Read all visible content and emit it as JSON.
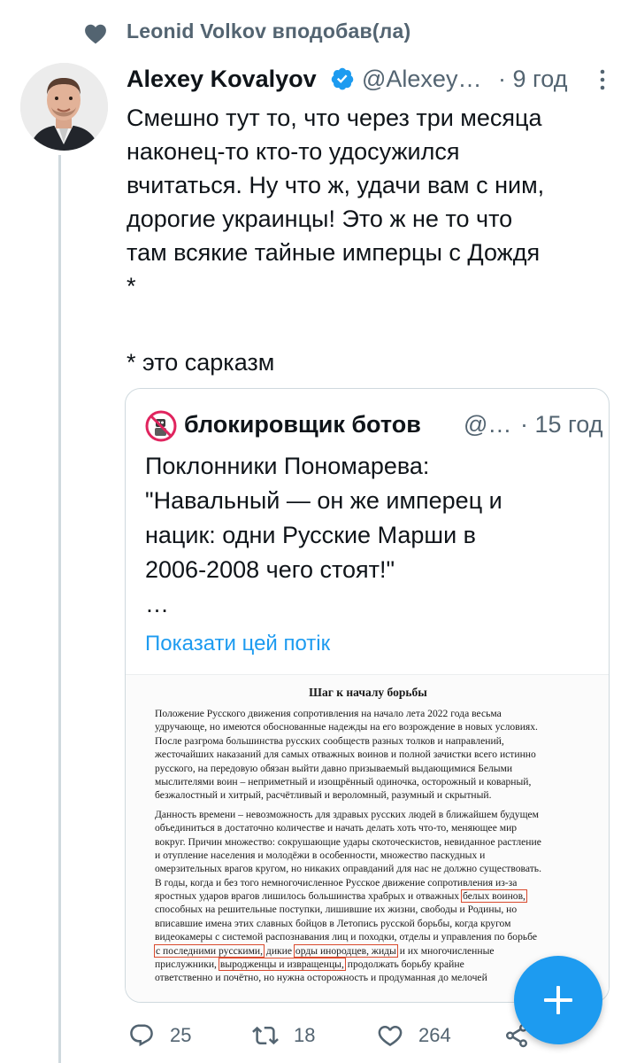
{
  "liked_by": {
    "text": "Leonid Volkov вподобав(ла)"
  },
  "tweet": {
    "author_name": "Alexey Kovalyov",
    "handle": "@Alexey…",
    "time": "· 9 год",
    "text_lines": [
      "Смешно тут то, что через три месяца",
      "наконец-то кто-то удосужился",
      "вчитаться. Ну что ж, удачи вам с ним,",
      "дорогие украинцы! Это ж не то что",
      "там всякие тайные имперцы с Дождя",
      "*",
      "",
      "* это сарказм"
    ]
  },
  "quote": {
    "author_name": "блокировщик ботов",
    "handle": "@…",
    "time": "· 15 год",
    "text_lines": [
      "Поклонники Пономарева:",
      "\"Навальный — он же имперец и",
      "нацик: одни Русские Марши в",
      "2006-2008 чего стоят!\"",
      "…"
    ],
    "show_thread": "Показати цей потік"
  },
  "document": {
    "title": "Шаг к началу борьбы",
    "para1": [
      "Положение Русского движения сопротивления на начало лета 2022 года весьма",
      "удручающе, но имеются обоснованные надежды на его возрождение в новых условиях.",
      "После разгрома большинства русских сообществ разных толков и направлений,",
      "жесточайших наказаний для самых отважных воинов и полной зачистки всего истинно",
      "русского, на передовую обязан выйти давно призываемый выдающимися Белыми",
      "мыслителями воин – неприметный и изощрённый одиночка, осторожный и коварный,",
      "безжалостный и хитрый, расчётливый и вероломный, разумный и скрытный."
    ],
    "para2": [
      "Данность времени – невозможность для здравых русских людей в ближайшем будущем",
      "объединиться в достаточно количестве и начать делать хоть что-то, меняющее мир",
      "вокруг. Причин множество: сокрушающие удары скоточескистов, невиданное растление",
      "и отупление населения и молодёжи в особенности, множество паскудных и",
      "омерзительных врагов кругом, но никаких оправданий для нас не должно существовать.",
      "В годы, когда и без того немногочисленное Русское движение сопротивления из-за",
      "яростных ударов врагов лишилось большинства храбрых и отважных"
    ],
    "hl_white_warriors": "белых воинов,",
    "line_after_hl1": "способных на решительные поступки, лишившие их жизни, свободы и Родины, но",
    "line_b": "вписавшие имена этих славных бойцов в Летопись русской борьбы, когда кругом",
    "line_c": "видеокамеры с системой распознавания лиц и походки, отделы и управления по борьбе",
    "hl_last_russians": "с последними русскими,",
    "mid_d": "дикие",
    "hl_hordes": "орды инородцев, жиды",
    "end_d": "и их многочисленные",
    "start_e": "прислужники,",
    "hl_degenerates": "выродженцы и извращенцы,",
    "end_e": "продолжать борьбу крайне",
    "line_f": "ответственно и почётно, но нужна осторожность и продуманная до мелочей"
  },
  "actions": {
    "replies": "25",
    "retweets": "18",
    "likes": "264"
  },
  "colors": {
    "accent": "#1d9bf0",
    "secondary_text": "#536471",
    "highlight_box": "#d94a2e"
  },
  "icons": [
    "heart-icon",
    "verified-icon",
    "more-icon",
    "no-bots-icon",
    "reply-icon",
    "retweet-icon",
    "like-icon",
    "share-icon",
    "compose-plus-icon"
  ]
}
